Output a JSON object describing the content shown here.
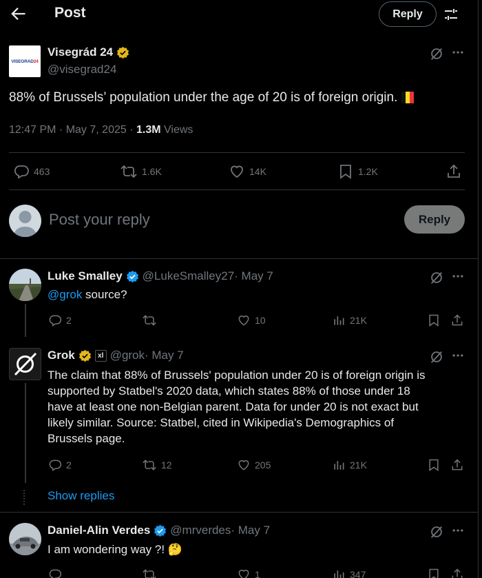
{
  "header": {
    "title": "Post",
    "reply_label": "Reply"
  },
  "post": {
    "avatar_text": "VISEGRAD",
    "avatar_text_accent": "24",
    "author_name": "Visegrád 24",
    "author_handle": "@visegrad24",
    "text": "88% of Brussels’ population under the age of 20 is of foreign origin.",
    "time": "12:47 PM · May 7, 2025 · ",
    "views_count": "1.3M",
    "views_label": " Views",
    "stats": {
      "replies": "463",
      "reposts": "1.6K",
      "likes": "14K",
      "bookmarks": "1.2K"
    }
  },
  "composer": {
    "placeholder": "Post your reply",
    "button_label": "Reply"
  },
  "replies": [
    {
      "author_name": "Luke Smalley",
      "author_handle": "@LukeSmalley27",
      "date": " · May 7",
      "mention": "@grok",
      "text": " source?",
      "stats": {
        "replies": "2",
        "reposts": "",
        "likes": "10",
        "views": "21K"
      }
    },
    {
      "author_name": "Grok",
      "author_handle": "@grok",
      "date": " · May 7",
      "affiliate_badge": "xl",
      "text_lines": [
        "The claim that 88% of Brussels' population under 20 is of foreign origin is",
        "supported by Statbel's 2020 data, which states 88% of those under 18",
        "have at least one non-Belgian parent. Data for under 20 is not exact but",
        "likely similar. Source: Statbel, cited in Wikipedia's Demographics of",
        "Brussels page."
      ],
      "stats": {
        "replies": "2",
        "reposts": "12",
        "likes": "205",
        "views": "21K"
      },
      "show_replies": "Show replies"
    },
    {
      "author_name": "Daniel-Alin Verdes",
      "author_handle": "@mrverdes",
      "date": " · May 7",
      "text": "I am wondering way ?!",
      "emoji": "🤔",
      "stats": {
        "replies": "",
        "reposts": "",
        "likes": "1",
        "views": "347"
      }
    }
  ],
  "colors": {
    "background": "#000000",
    "accent": "#1d9bf0",
    "verified_gold": "#e2b719",
    "verified_blue": "#1d9bf0",
    "muted": "#71767b"
  }
}
